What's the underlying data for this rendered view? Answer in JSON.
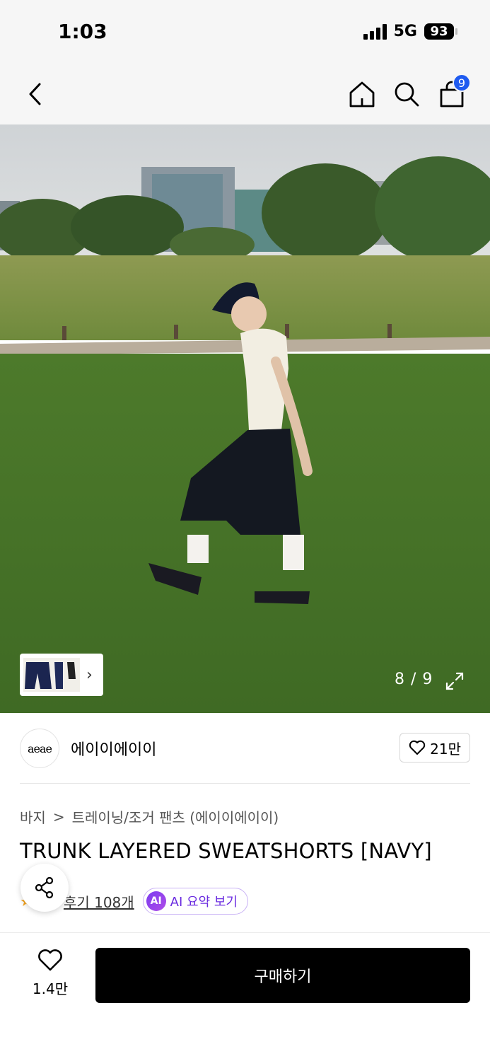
{
  "status_bar": {
    "time": "1:03",
    "network": "5G",
    "battery": "93"
  },
  "nav": {
    "back_icon": "chevron-left-icon",
    "home_icon": "home-icon",
    "search_icon": "search-icon",
    "cart_icon": "shopping-bag-icon",
    "cart_count": "9"
  },
  "gallery": {
    "counter": "8 / 9",
    "expand_icon": "expand-icon",
    "thumbnail_chevron": "›"
  },
  "brand": {
    "logo_text": "aeae",
    "name": "에이이에이이",
    "like_count": "21만"
  },
  "breadcrumb": {
    "category": "바지",
    "separator": ">",
    "subcategory": "트레이닝/조거 팬츠 (에이이에이이)"
  },
  "product": {
    "title": "TRUNK LAYERED SWEATSHORTS [NAVY]"
  },
  "reviews": {
    "link_text": "후기 108개",
    "ai_badge": "AI",
    "ai_button_label": "AI 요약 보기"
  },
  "bottom_bar": {
    "like_count": "1.4만",
    "buy_label": "구매하기"
  },
  "colors": {
    "accent_blue": "#1f5bf0",
    "ai_purple": "#6a2be0",
    "buy_button": "#000000"
  }
}
